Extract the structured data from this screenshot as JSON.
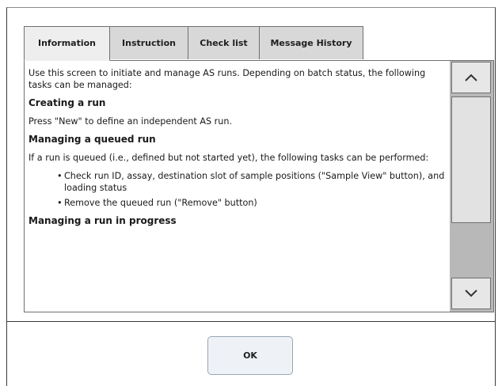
{
  "tabs": [
    {
      "label": "Information",
      "active": true
    },
    {
      "label": "Instruction",
      "active": false
    },
    {
      "label": "Check list",
      "active": false
    },
    {
      "label": "Message History",
      "active": false
    }
  ],
  "content": {
    "intro": "Use this screen to initiate and manage AS runs. Depending on batch status, the following tasks can be managed:",
    "heading_create": "Creating a run",
    "create_text": "Press \"New\" to define an independent AS run.",
    "heading_queued": "Managing a queued run",
    "queued_text": "If a run is queued (i.e., defined but not started yet), the following tasks can be performed:",
    "queued_items": [
      "Check run ID, assay, destination slot of sample positions (\"Sample View\" button), and loading status",
      "Remove the queued run (\"Remove\" button)"
    ],
    "heading_progress": "Managing a run in progress"
  },
  "scrollbar": {
    "up_icon": "chevron-up-icon",
    "down_icon": "chevron-down-icon"
  },
  "footer": {
    "ok_label": "OK"
  }
}
